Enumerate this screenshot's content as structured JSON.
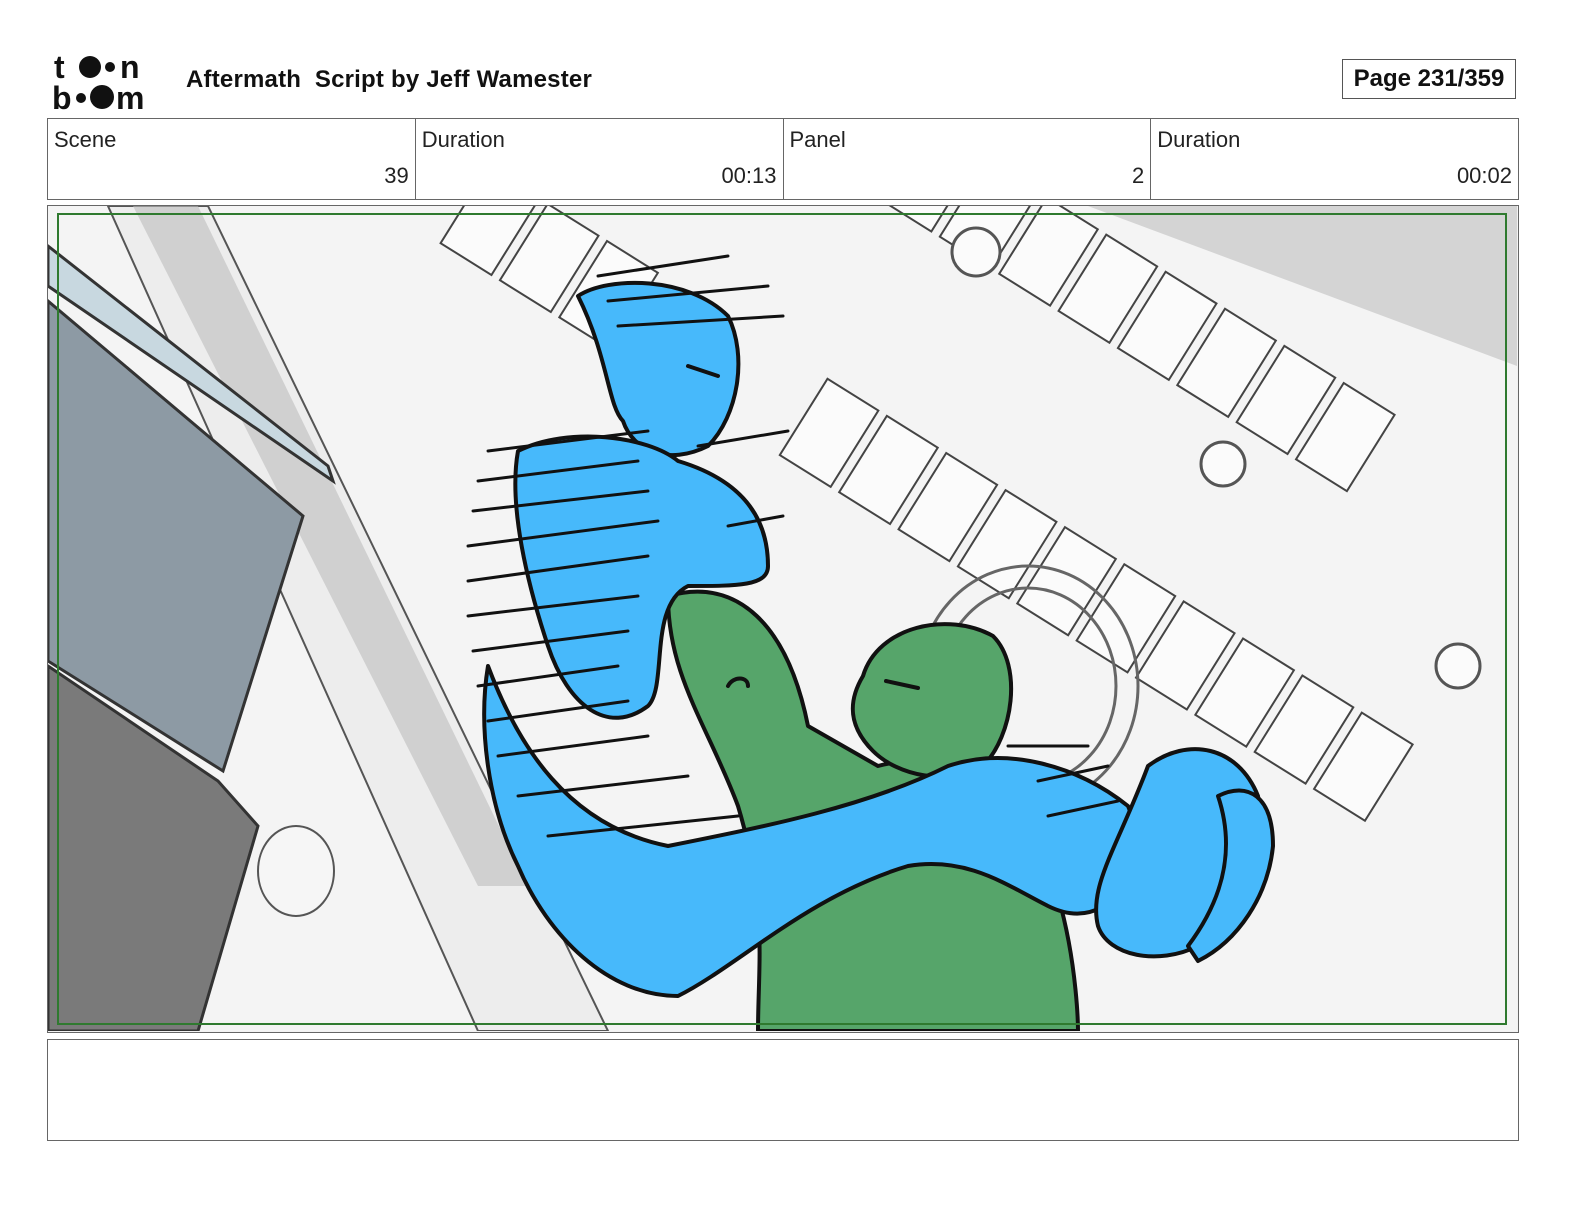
{
  "header": {
    "logo_text_top": "toon",
    "logo_text_bottom": "boom",
    "title": "Aftermath  Script by Jeff Wamester",
    "page_label": "Page 231/359"
  },
  "info": {
    "scene_label": "Scene",
    "scene_value": "39",
    "scene_duration_label": "Duration",
    "scene_duration_value": "00:13",
    "panel_label": "Panel",
    "panel_value": "2",
    "panel_duration_label": "Duration",
    "panel_duration_value": "00:02"
  },
  "panel": {
    "colors": {
      "figure_blue": "#47b9fb",
      "figure_green": "#56a56a",
      "safe_frame": "#2f7a2f",
      "background": "#f2f2f2"
    }
  },
  "notes": {
    "text": ""
  }
}
